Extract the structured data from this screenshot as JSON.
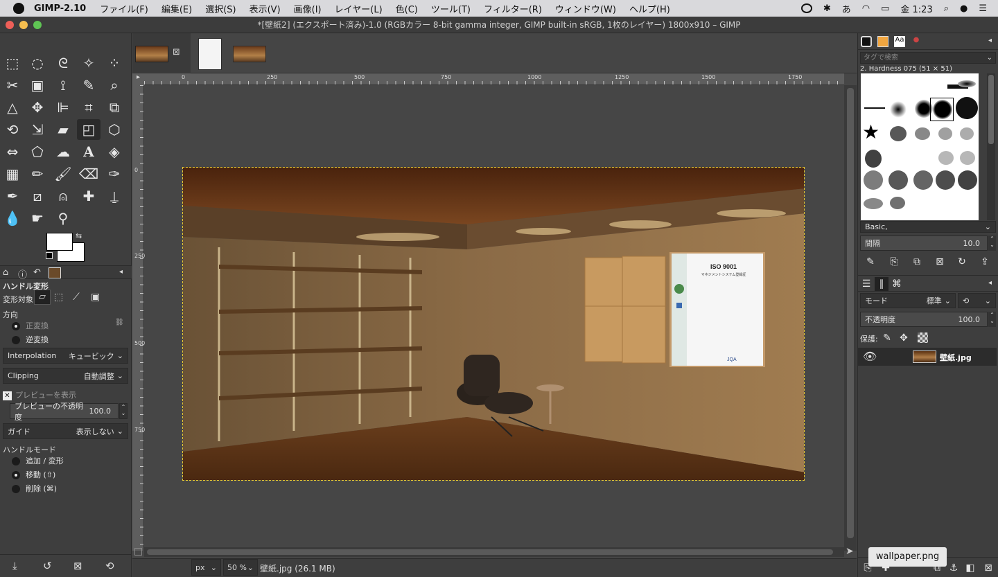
{
  "menubar": {
    "app_name": "GIMP-2.10",
    "items": [
      "ファイル(F)",
      "編集(E)",
      "選択(S)",
      "表示(V)",
      "画像(I)",
      "レイヤー(L)",
      "色(C)",
      "ツール(T)",
      "フィルター(R)",
      "ウィンドウ(W)",
      "ヘルプ(H)"
    ],
    "input_method": "あ",
    "clock": "金 1:23"
  },
  "window": {
    "title": "*[壁紙2] (エクスポート済み)-1.0 (RGBカラー 8-bit gamma integer, GIMP built-in sRGB, 1枚のレイヤー) 1800x910 – GIMP"
  },
  "tool_options": {
    "title": "ハンドル変形",
    "transform_label": "変形対象:",
    "direction_label": "方向",
    "direction_normal": "正変換",
    "direction_reverse": "逆変換",
    "interpolation_label": "Interpolation",
    "interpolation_value": "キュービック",
    "clipping_label": "Clipping",
    "clipping_value": "自動調整",
    "preview_label": "プレビューを表示",
    "preview_opacity_label": "プレビューの不透明度",
    "preview_opacity_value": "100.0",
    "guide_label": "ガイド",
    "guide_value": "表示しない",
    "handle_mode_label": "ハンドルモード",
    "handle_add": "追加 / 変形",
    "handle_move": "移動 (⇧)",
    "handle_delete": "削除 (⌘)"
  },
  "ruler": {
    "top_marks": [
      "0",
      "250",
      "500",
      "750",
      "1000",
      "1250",
      "1500",
      "1750"
    ],
    "left_marks": [
      "0",
      "250",
      "500",
      "750"
    ]
  },
  "status": {
    "unit": "px",
    "zoom": "50 %",
    "file_info": "壁紙.jpg (26.1 MB)"
  },
  "brushes": {
    "tag_placeholder": "タグで検索",
    "brush_name": "2. Hardness 075 (51 × 51)",
    "preset": "Basic,",
    "spacing_label": "間隔",
    "spacing_value": "10.0"
  },
  "layers": {
    "mode_label": "モード",
    "mode_value": "標準",
    "opacity_label": "不透明度",
    "opacity_value": "100.0",
    "lock_label": "保護:",
    "layer_name": "壁紙.jpg"
  },
  "tooltip": "wallpaper.png",
  "iso_doc": {
    "title": "ISO 9001",
    "subtitle": "マネジメントシステム登録証",
    "brand": "JQA"
  }
}
